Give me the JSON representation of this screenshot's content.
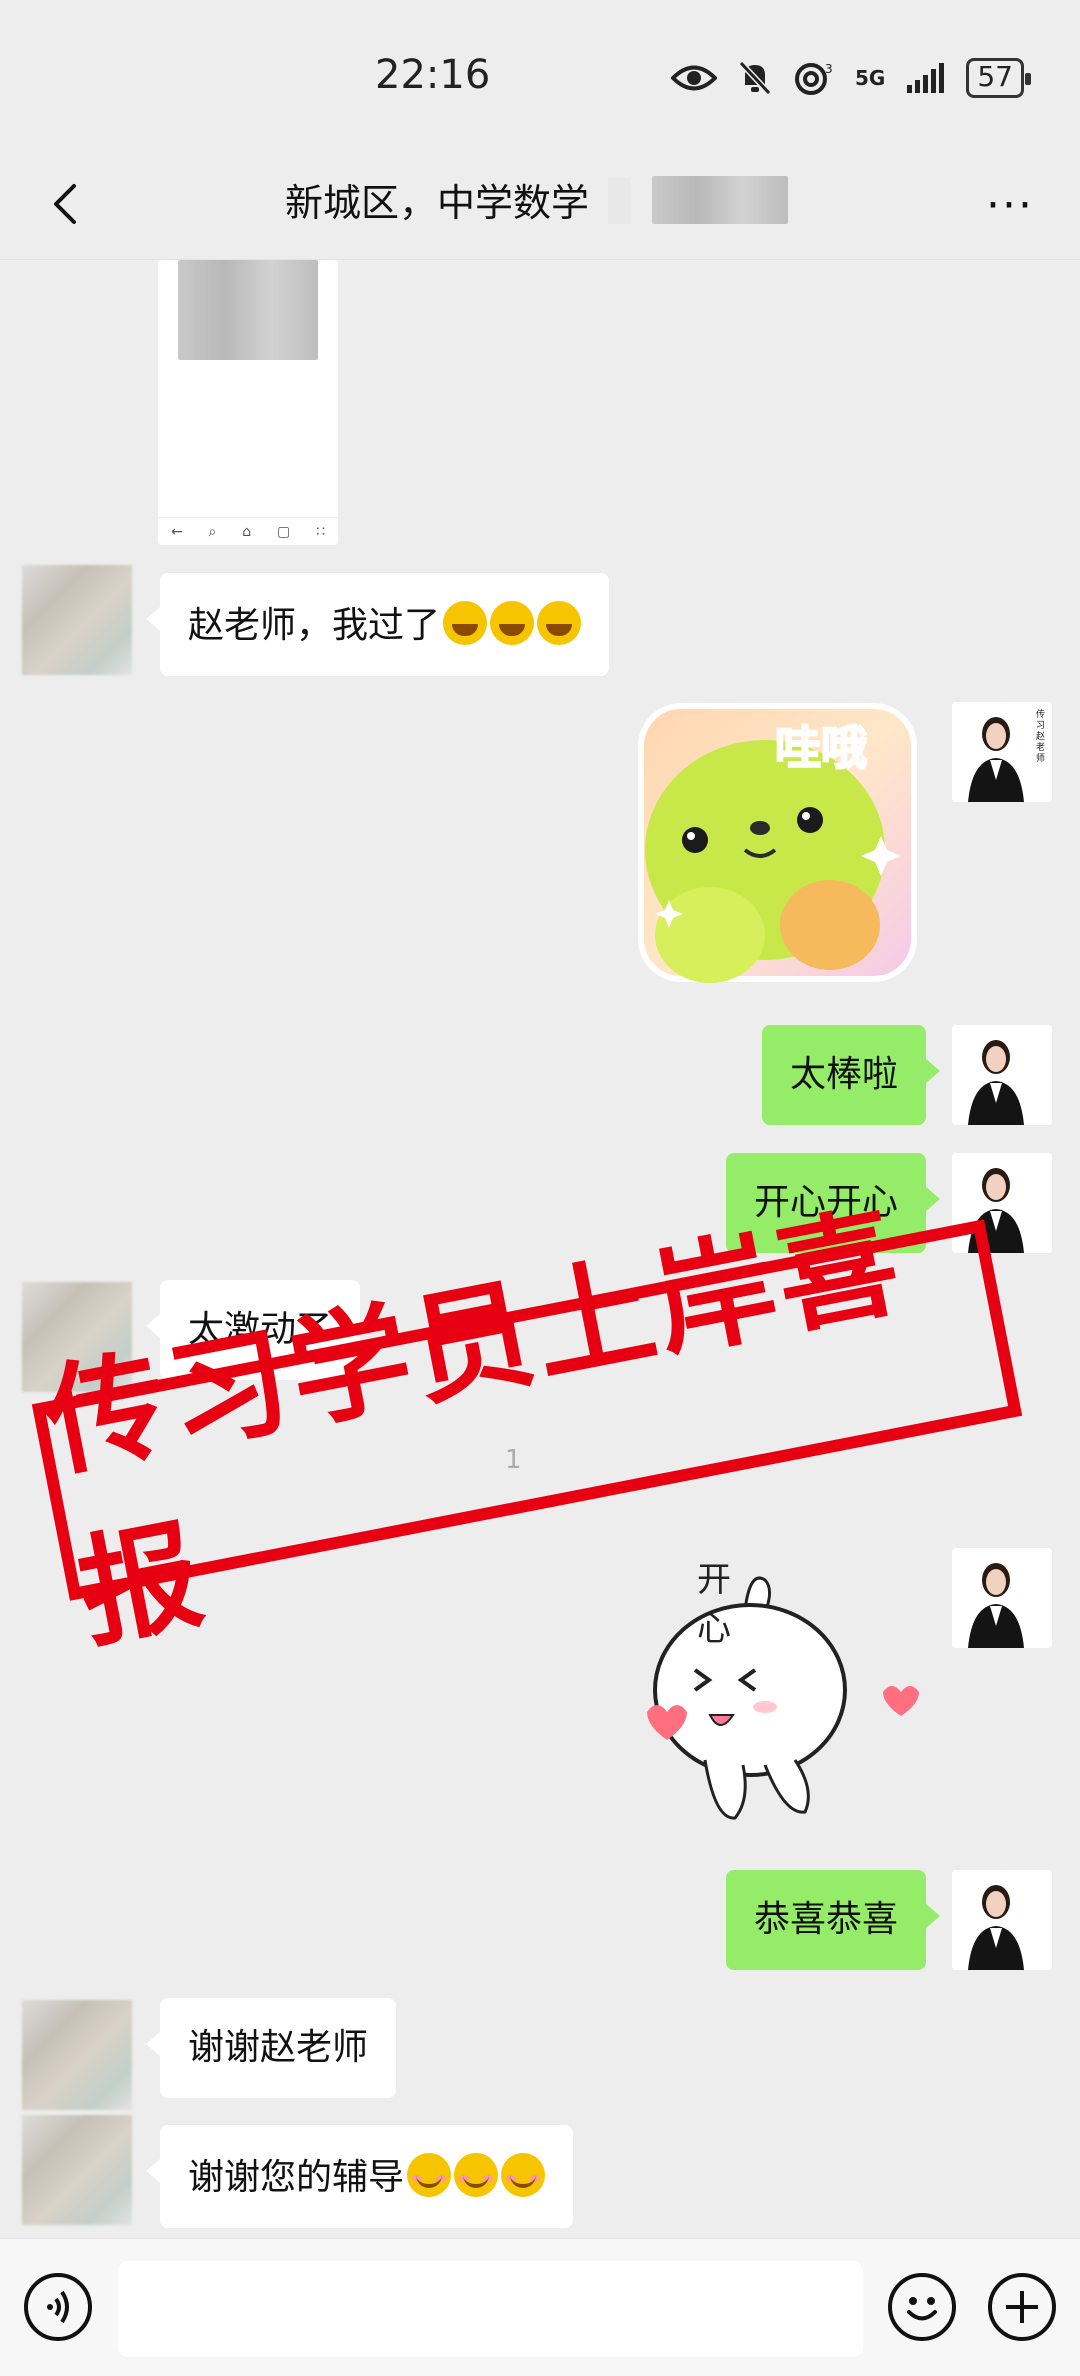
{
  "status_bar": {
    "time": "22:16",
    "network": "5G",
    "battery": "57"
  },
  "header": {
    "title": "新城区，中学数学",
    "more": "···"
  },
  "messages": [
    {
      "side": "left",
      "type": "image"
    },
    {
      "side": "left",
      "type": "text",
      "text": "赵老师，我过了",
      "emoji": [
        "grin",
        "grin",
        "grin"
      ]
    },
    {
      "side": "right",
      "type": "sticker",
      "caption": "哇哦"
    },
    {
      "side": "right",
      "type": "text",
      "text": "太棒啦"
    },
    {
      "side": "right",
      "type": "text",
      "text": "开心开心"
    },
    {
      "side": "left",
      "type": "text",
      "text": "太激动了"
    },
    {
      "side": "right",
      "type": "sticker",
      "caption": "开 心"
    },
    {
      "side": "right",
      "type": "text",
      "text": "恭喜恭喜"
    },
    {
      "side": "left",
      "type": "text",
      "text": "谢谢赵老师"
    },
    {
      "side": "left",
      "type": "text",
      "text": "谢谢您的辅导",
      "emoji": [
        "smile",
        "smile",
        "smile"
      ]
    }
  ],
  "stamp": {
    "text": "传习学员上岸喜报"
  },
  "teacher_avatar": {
    "caption": "传习赵老师"
  },
  "timestamp_fragment": "1",
  "colors": {
    "background": "#ededed",
    "bubble_right": "#95ec69",
    "bubble_left": "#ffffff",
    "stamp": "#e60012"
  }
}
